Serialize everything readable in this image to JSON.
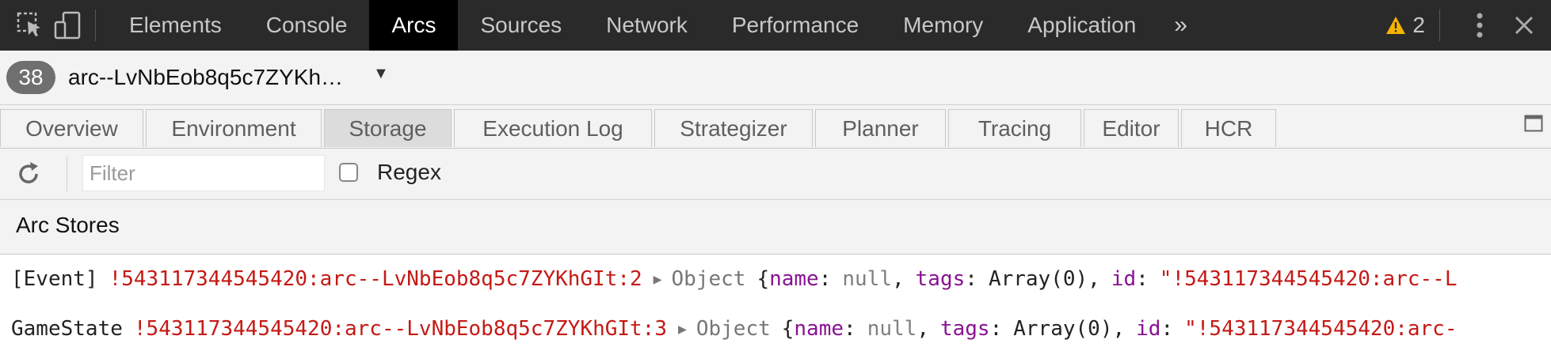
{
  "devtools": {
    "tabs": [
      "Elements",
      "Console",
      "Arcs",
      "Sources",
      "Network",
      "Performance",
      "Memory",
      "Application"
    ],
    "active_tab": "Arcs",
    "overflow_label": "»",
    "warning_count": "2"
  },
  "arc": {
    "count_badge": "38",
    "name": "arc--LvNbEob8q5c7ZYKh…",
    "dropdown_icon": "▼"
  },
  "subtabs": {
    "items": [
      "Overview",
      "Environment",
      "Storage",
      "Execution Log",
      "Strategizer",
      "Planner",
      "Tracing",
      "Editor",
      "HCR"
    ],
    "active": "Storage"
  },
  "toolbar": {
    "filter_placeholder": "Filter",
    "regex_label": "Regex"
  },
  "section": {
    "title": "Arc Stores"
  },
  "stores": [
    {
      "name": "[Event]",
      "id": "!543117344545420:arc--LvNbEob8q5c7ZYKhGIt:2",
      "preview_type": "Object",
      "open_brace": "{",
      "k1": "name",
      "v1": "null",
      "k2": "tags",
      "v2": "Array(0)",
      "k3": "id",
      "v3": "\"!543117344545420:arc--L"
    },
    {
      "name": "GameState",
      "id": "!543117344545420:arc--LvNbEob8q5c7ZYKhGIt:3",
      "preview_type": "Object",
      "open_brace": "{",
      "k1": "name",
      "v1": "null",
      "k2": "tags",
      "v2": "Array(0)",
      "k3": "id",
      "v3": "\"!543117344545420:arc-"
    }
  ],
  "colors": {
    "topbar_bg": "#2a2a2a",
    "active_tab_bg": "#000000",
    "string_red": "#c41a16",
    "key_purple": "#881391",
    "warning_yellow": "#f5b400"
  }
}
